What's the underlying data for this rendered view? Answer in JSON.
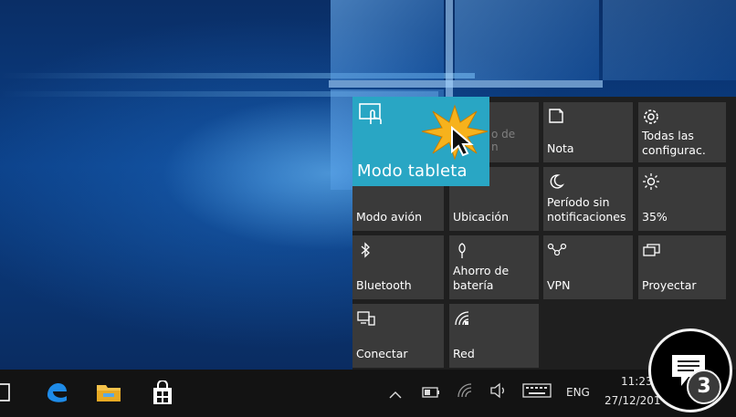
{
  "action_center": {
    "tiles": [
      {
        "id": "tablet-mode",
        "label": "Modo tableta",
        "icon": "tablet-mode-icon",
        "state": "on"
      },
      {
        "id": "note",
        "label": "Nota",
        "icon": "note-icon"
      },
      {
        "id": "all-settings",
        "label": "Todas las configurac.",
        "icon": "gear-icon"
      },
      {
        "id": "airplane",
        "label": "Modo avión",
        "icon": "airplane-icon"
      },
      {
        "id": "location",
        "label": "Ubicación",
        "icon": "location-icon"
      },
      {
        "id": "quiet-hours",
        "label": "Período sin notificaciones",
        "icon": "moon-icon"
      },
      {
        "id": "brightness",
        "label": "35%",
        "icon": "brightness-icon"
      },
      {
        "id": "bluetooth",
        "label": "Bluetooth",
        "icon": "bluetooth-icon"
      },
      {
        "id": "battery-saver",
        "label": "Ahorro de batería",
        "icon": "battery-saver-icon"
      },
      {
        "id": "vpn",
        "label": "VPN",
        "icon": "vpn-icon"
      },
      {
        "id": "project",
        "label": "Proyectar",
        "icon": "project-icon"
      },
      {
        "id": "connect",
        "label": "Conectar",
        "icon": "connect-icon"
      },
      {
        "id": "network",
        "label": "Red",
        "icon": "network-icon"
      }
    ],
    "partial_hidden_text": "o de\nn"
  },
  "taskbar": {
    "pinned": [
      "task-view-icon",
      "edge-icon",
      "file-explorer-icon",
      "store-icon"
    ],
    "tray": {
      "language": "ENG",
      "time": "11:23",
      "date": "27/12/201"
    }
  },
  "notifications": {
    "count": "3"
  },
  "colors": {
    "accent": "#29a6c4",
    "tile": "#3a3a3a",
    "panel": "#1f1f1f",
    "taskbar": "#131313"
  }
}
